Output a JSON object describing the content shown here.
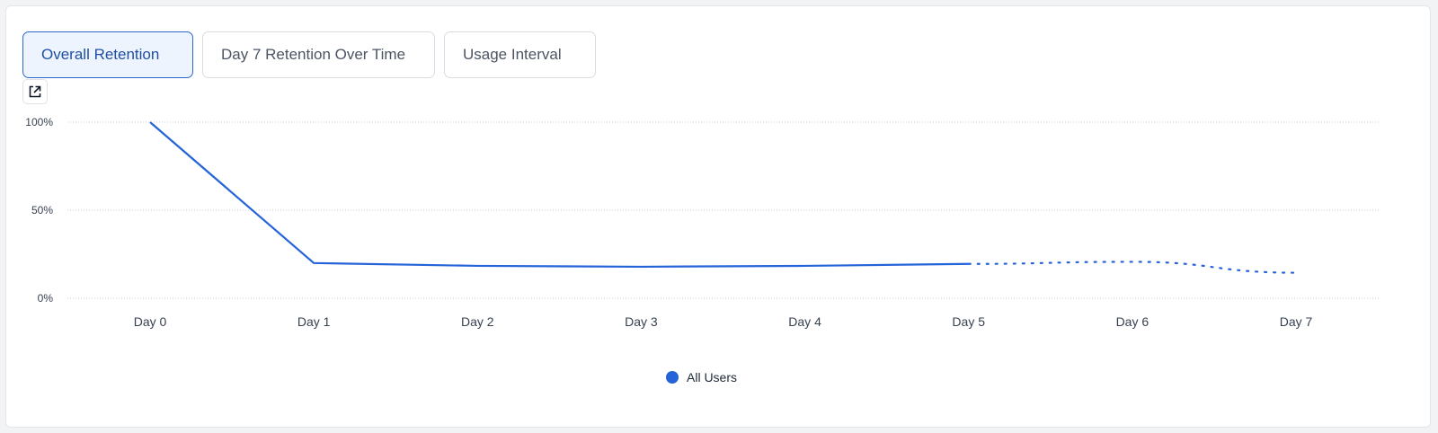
{
  "tabs": [
    {
      "label": "Overall Retention",
      "active": true
    },
    {
      "label": "Day 7 Retention Over Time",
      "active": false
    },
    {
      "label": "Usage Interval",
      "active": false
    }
  ],
  "toolbar": {
    "open_icon": "open-in-new-icon"
  },
  "colors": {
    "series": "#2563d9",
    "grid": "#c9ccd1",
    "active_tab_bg": "#eef4fd",
    "active_tab_border": "#2e68c9"
  },
  "chart_data": {
    "type": "line",
    "categories": [
      "Day 0",
      "Day 1",
      "Day 2",
      "Day 3",
      "Day 4",
      "Day 5",
      "Day 6",
      "Day 7"
    ],
    "y_ticks": [
      "100%",
      "50%",
      "0%"
    ],
    "ylim": [
      0,
      100
    ],
    "grid": true,
    "legend_position": "bottom-center",
    "series": [
      {
        "name": "All Users",
        "color": "#2563d9",
        "values": [
          100,
          20,
          18.4,
          17.9,
          18.4,
          19.5,
          20.7,
          14.5
        ],
        "solid_through_index": 5,
        "dotted_after_index": 5
      }
    ]
  }
}
